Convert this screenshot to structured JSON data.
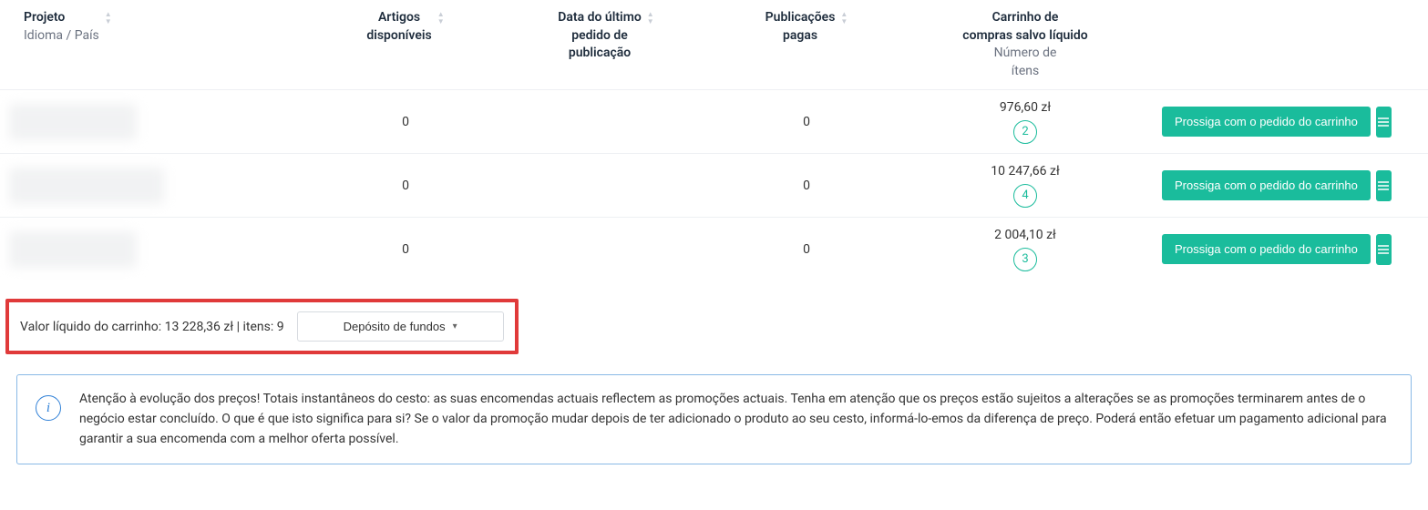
{
  "columns": {
    "project": {
      "title": "Projeto",
      "subtitle": "Idioma / País"
    },
    "articles": {
      "title": "Artigos",
      "subtitle": "disponíveis"
    },
    "date": {
      "title": "Data do último",
      "subtitle1": "pedido de",
      "subtitle2": "publicação"
    },
    "pubs": {
      "title": "Publicações",
      "subtitle": "pagas"
    },
    "cart": {
      "title": "Carrinho de",
      "subtitle1": "compras salvo líquido",
      "subtitle2": "Número de",
      "subtitle3": "ítens"
    }
  },
  "rows": [
    {
      "articles": "0",
      "date": "",
      "pubs": "0",
      "cart_price": "976,60 zł",
      "cart_items": "2",
      "action": "Prossiga com o pedido do carrinho"
    },
    {
      "articles": "0",
      "date": "",
      "pubs": "0",
      "cart_price": "10 247,66 zł",
      "cart_items": "4",
      "action": "Prossiga com o pedido do carrinho"
    },
    {
      "articles": "0",
      "date": "",
      "pubs": "0",
      "cart_price": "2 004,10 zł",
      "cart_items": "3",
      "action": "Prossiga com o pedido do carrinho"
    }
  ],
  "summary": {
    "label_value_prefix": "Valor líquido do carrinho: ",
    "value": "13 228,36 zł",
    "items_prefix": " | itens: ",
    "items": "9",
    "deposit_label": "Depósito de fundos"
  },
  "info": {
    "text": "Atenção à evolução dos preços! Totais instantâneos do cesto: as suas encomendas actuais reflectem as promoções actuais. Tenha em atenção que os preços estão sujeitos a alterações se as promoções terminarem antes de o negócio estar concluído. O que é que isto significa para si? Se o valor da promoção mudar depois de ter adicionado o produto ao seu cesto, informá-lo-emos da diferença de preço. Poderá então efetuar um pagamento adicional para garantir a sua encomenda com a melhor oferta possível."
  }
}
